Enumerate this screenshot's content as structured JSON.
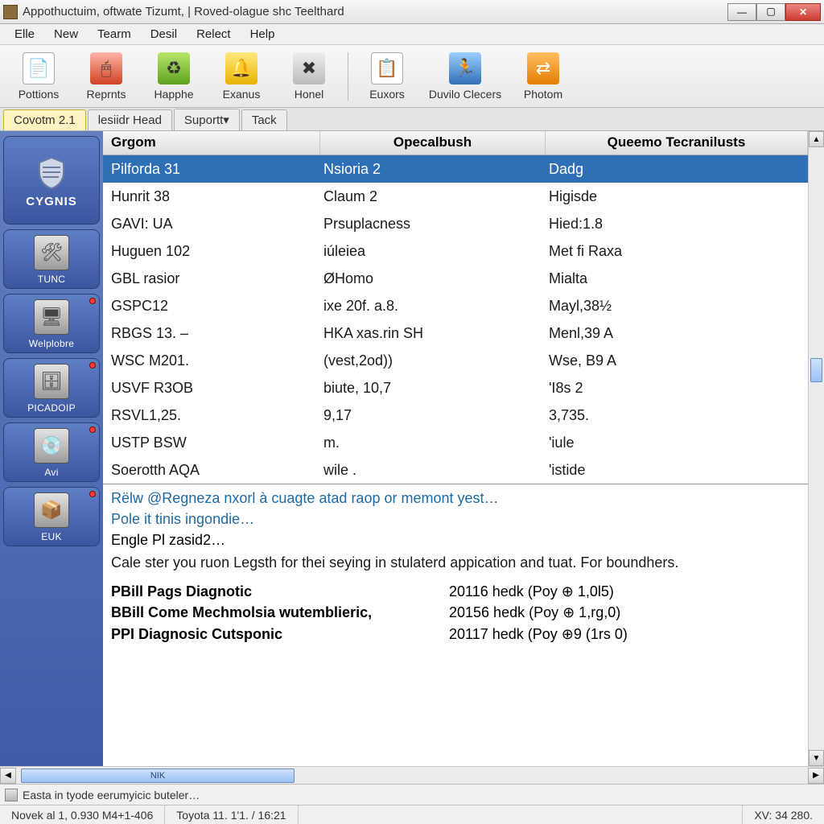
{
  "window": {
    "title": "Appothuctuim, oftwate Tizumt, | Roved-olague shc Teelthard"
  },
  "menu": {
    "items": [
      "Elle",
      "New",
      "Tearm",
      "Desil",
      "Relect",
      "Help"
    ]
  },
  "toolbar": {
    "groups": [
      [
        {
          "label": "Pottions",
          "icon": "white"
        },
        {
          "label": "Reprnts",
          "icon": "red"
        },
        {
          "label": "Happhe",
          "icon": "green"
        },
        {
          "label": "Exanus",
          "icon": "yellow"
        },
        {
          "label": "Honel",
          "icon": "grey"
        }
      ],
      [
        {
          "label": "Euxors",
          "icon": "white"
        },
        {
          "label": "Duvilo Clecers",
          "icon": "blue"
        },
        {
          "label": "Photom",
          "icon": "orange"
        }
      ]
    ]
  },
  "tabs": [
    {
      "label": "Covotm 2.1",
      "active": true
    },
    {
      "label": "lesiidr Head",
      "active": false
    },
    {
      "label": "Suportt▾",
      "active": false
    },
    {
      "label": "Tack",
      "active": false
    }
  ],
  "sidebar": [
    {
      "label": "CYGNIS",
      "kind": "logo"
    },
    {
      "label": "TUNC",
      "icon": "⚙"
    },
    {
      "label": "Welplobre",
      "icon": "▭",
      "dot": true
    },
    {
      "label": "PICADOIP",
      "icon": "▥",
      "dot": true
    },
    {
      "label": "Avi",
      "icon": "✚",
      "dot": true
    },
    {
      "label": "EUK",
      "icon": "⧈",
      "dot": true
    }
  ],
  "grid": {
    "headers": [
      "Grgom",
      "Opecalbush",
      "Queemo Tecranilusts"
    ],
    "rows": [
      {
        "c1": "Pilforda 31",
        "c2": "Nsioria 2",
        "c3": "Dadg",
        "sel": true
      },
      {
        "c1": "Hunrit 38",
        "c2": "Claum 2",
        "c3": "Higisde"
      },
      {
        "c1": "GAVI: UA",
        "c2": "Prsuplacness",
        "c3": "Hied:1.8"
      },
      {
        "c1": "Huguen 102",
        "c2": "iúleiea",
        "c3": "Met fi Raxa"
      },
      {
        "c1": "GBL rasior",
        "c2": "ØHomo",
        "c3": "Mialta"
      },
      {
        "c1": "GSPC12",
        "c2": "ixe 20f. a.8.",
        "c3": "Mayl,38½"
      },
      {
        "c1": "RBGS 13. –",
        "c2": "HKA xas.rin SH",
        "c3": "Menl,39 A"
      },
      {
        "c1": "WSC M201.",
        "c2": "(vest,2od))",
        "c3": "Wse, B9 A"
      },
      {
        "c1": "USVF R3OB",
        "c2": "biute, 10,7",
        "c3": "'I8s 2"
      },
      {
        "c1": "RSVL1,25.",
        "c2": "9,17",
        "c3": "3,735."
      },
      {
        "c1": "USTP BSW",
        "c2": "m.",
        "c3": "'iule"
      },
      {
        "c1": "Soerotth AQA",
        "c2": "wile .",
        "c3": "'istide"
      }
    ]
  },
  "detail": {
    "link1": "Rëlw @Regneza nxorl à cuagte atad raop or memont yest…",
    "link2": "Pole it tinis ingondie…",
    "line3": "Engle Pl zasid2…",
    "note": "Cale ster you ruon Legsth for thei seying in stulaterd appication and tuat. For boundhers.",
    "items": [
      {
        "name": "PBill Pags Diagnotic",
        "val": "20116 hedk (Poy ⊕ 1,0l5)"
      },
      {
        "name": "BBill Come Mechmolsia wutemblieric,",
        "val": "20156 hedk (Poy ⊕ 1,rg,0)"
      },
      {
        "name": "PPI Diagnosic Cutsponic",
        "val": "20117 hedk (Poy ⊕9 (1rs 0)"
      }
    ]
  },
  "hscroll": {
    "thumb_label": "NIK"
  },
  "status": {
    "task": "Easta in tyode eerumyicic buteler…",
    "left": "Novek al  1, 0.930 M4+1-406",
    "mid": "Toyota  11. 1'1. /  16:21",
    "right": "XV: 34 280."
  }
}
